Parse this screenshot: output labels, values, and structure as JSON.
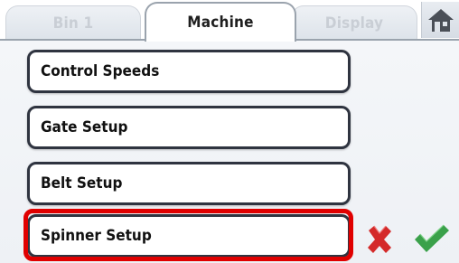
{
  "tabs": [
    {
      "label": "Bin 1",
      "state": "inactive"
    },
    {
      "label": "Machine",
      "state": "active"
    },
    {
      "label": "Display",
      "state": "inactive"
    }
  ],
  "home": {
    "icon": "home-icon"
  },
  "menu": {
    "items": [
      {
        "label": "Control Speeds"
      },
      {
        "label": "Gate Setup"
      },
      {
        "label": "Belt Setup"
      },
      {
        "label": "Spinner Setup",
        "highlighted": true
      }
    ]
  },
  "actions": {
    "cancel": {
      "icon": "cancel-x-icon",
      "color": "#d42a2a"
    },
    "confirm": {
      "icon": "checkmark-icon",
      "color": "#3aa14a"
    }
  },
  "colors": {
    "highlight": "#e00000",
    "button_border": "#2f3440"
  }
}
